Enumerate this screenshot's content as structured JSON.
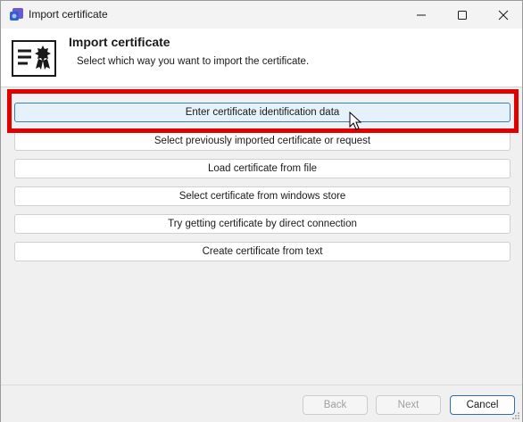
{
  "window": {
    "title": "Import certificate"
  },
  "header": {
    "title": "Import certificate",
    "subtitle": "Select which way you want to import the certificate."
  },
  "options": [
    {
      "label": "Enter certificate identification data",
      "highlighted": true
    },
    {
      "label": "Select previously imported certificate or request"
    },
    {
      "label": "Load certificate from file"
    },
    {
      "label": "Select certificate from windows store"
    },
    {
      "label": "Try getting certificate by direct connection"
    },
    {
      "label": "Create certificate from text"
    }
  ],
  "footer": {
    "back_label": "Back",
    "next_label": "Next",
    "cancel_label": "Cancel"
  },
  "colors": {
    "highlight_border": "#e00000",
    "hover_fill": "#e5f1fb",
    "focus_border": "#2f6fb0"
  }
}
